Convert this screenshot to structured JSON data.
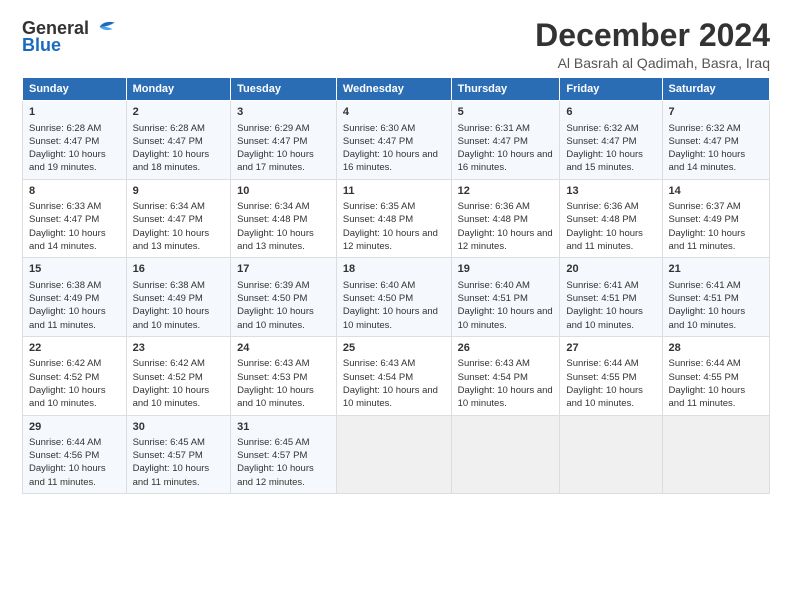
{
  "logo": {
    "line1": "General",
    "line2": "Blue"
  },
  "title": "December 2024",
  "subtitle": "Al Basrah al Qadimah, Basra, Iraq",
  "days_of_week": [
    "Sunday",
    "Monday",
    "Tuesday",
    "Wednesday",
    "Thursday",
    "Friday",
    "Saturday"
  ],
  "weeks": [
    [
      {
        "day": 1,
        "sunrise": "6:28 AM",
        "sunset": "4:47 PM",
        "daylight": "10 hours and 19 minutes."
      },
      {
        "day": 2,
        "sunrise": "6:28 AM",
        "sunset": "4:47 PM",
        "daylight": "10 hours and 18 minutes."
      },
      {
        "day": 3,
        "sunrise": "6:29 AM",
        "sunset": "4:47 PM",
        "daylight": "10 hours and 17 minutes."
      },
      {
        "day": 4,
        "sunrise": "6:30 AM",
        "sunset": "4:47 PM",
        "daylight": "10 hours and 16 minutes."
      },
      {
        "day": 5,
        "sunrise": "6:31 AM",
        "sunset": "4:47 PM",
        "daylight": "10 hours and 16 minutes."
      },
      {
        "day": 6,
        "sunrise": "6:32 AM",
        "sunset": "4:47 PM",
        "daylight": "10 hours and 15 minutes."
      },
      {
        "day": 7,
        "sunrise": "6:32 AM",
        "sunset": "4:47 PM",
        "daylight": "10 hours and 14 minutes."
      }
    ],
    [
      {
        "day": 8,
        "sunrise": "6:33 AM",
        "sunset": "4:47 PM",
        "daylight": "10 hours and 14 minutes."
      },
      {
        "day": 9,
        "sunrise": "6:34 AM",
        "sunset": "4:47 PM",
        "daylight": "10 hours and 13 minutes."
      },
      {
        "day": 10,
        "sunrise": "6:34 AM",
        "sunset": "4:48 PM",
        "daylight": "10 hours and 13 minutes."
      },
      {
        "day": 11,
        "sunrise": "6:35 AM",
        "sunset": "4:48 PM",
        "daylight": "10 hours and 12 minutes."
      },
      {
        "day": 12,
        "sunrise": "6:36 AM",
        "sunset": "4:48 PM",
        "daylight": "10 hours and 12 minutes."
      },
      {
        "day": 13,
        "sunrise": "6:36 AM",
        "sunset": "4:48 PM",
        "daylight": "10 hours and 11 minutes."
      },
      {
        "day": 14,
        "sunrise": "6:37 AM",
        "sunset": "4:49 PM",
        "daylight": "10 hours and 11 minutes."
      }
    ],
    [
      {
        "day": 15,
        "sunrise": "6:38 AM",
        "sunset": "4:49 PM",
        "daylight": "10 hours and 11 minutes."
      },
      {
        "day": 16,
        "sunrise": "6:38 AM",
        "sunset": "4:49 PM",
        "daylight": "10 hours and 10 minutes."
      },
      {
        "day": 17,
        "sunrise": "6:39 AM",
        "sunset": "4:50 PM",
        "daylight": "10 hours and 10 minutes."
      },
      {
        "day": 18,
        "sunrise": "6:40 AM",
        "sunset": "4:50 PM",
        "daylight": "10 hours and 10 minutes."
      },
      {
        "day": 19,
        "sunrise": "6:40 AM",
        "sunset": "4:51 PM",
        "daylight": "10 hours and 10 minutes."
      },
      {
        "day": 20,
        "sunrise": "6:41 AM",
        "sunset": "4:51 PM",
        "daylight": "10 hours and 10 minutes."
      },
      {
        "day": 21,
        "sunrise": "6:41 AM",
        "sunset": "4:51 PM",
        "daylight": "10 hours and 10 minutes."
      }
    ],
    [
      {
        "day": 22,
        "sunrise": "6:42 AM",
        "sunset": "4:52 PM",
        "daylight": "10 hours and 10 minutes."
      },
      {
        "day": 23,
        "sunrise": "6:42 AM",
        "sunset": "4:52 PM",
        "daylight": "10 hours and 10 minutes."
      },
      {
        "day": 24,
        "sunrise": "6:43 AM",
        "sunset": "4:53 PM",
        "daylight": "10 hours and 10 minutes."
      },
      {
        "day": 25,
        "sunrise": "6:43 AM",
        "sunset": "4:54 PM",
        "daylight": "10 hours and 10 minutes."
      },
      {
        "day": 26,
        "sunrise": "6:43 AM",
        "sunset": "4:54 PM",
        "daylight": "10 hours and 10 minutes."
      },
      {
        "day": 27,
        "sunrise": "6:44 AM",
        "sunset": "4:55 PM",
        "daylight": "10 hours and 10 minutes."
      },
      {
        "day": 28,
        "sunrise": "6:44 AM",
        "sunset": "4:55 PM",
        "daylight": "10 hours and 11 minutes."
      }
    ],
    [
      {
        "day": 29,
        "sunrise": "6:44 AM",
        "sunset": "4:56 PM",
        "daylight": "10 hours and 11 minutes."
      },
      {
        "day": 30,
        "sunrise": "6:45 AM",
        "sunset": "4:57 PM",
        "daylight": "10 hours and 11 minutes."
      },
      {
        "day": 31,
        "sunrise": "6:45 AM",
        "sunset": "4:57 PM",
        "daylight": "10 hours and 12 minutes."
      },
      null,
      null,
      null,
      null
    ]
  ]
}
